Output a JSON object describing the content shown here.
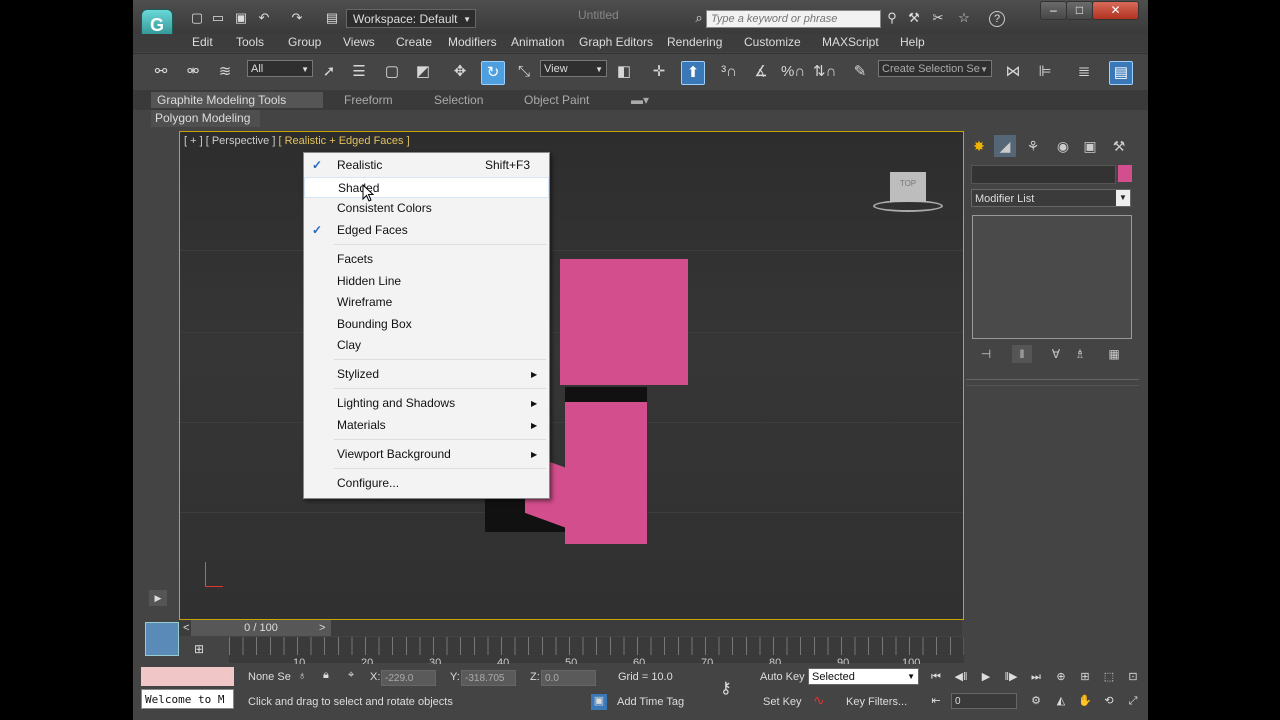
{
  "app": {
    "logo": "G",
    "workspace_label": "Workspace: Default",
    "window_title": "Untitled",
    "search_placeholder": "Type a keyword or phrase",
    "controls": {
      "minimize": "–",
      "maximize": "□",
      "close": "✕"
    }
  },
  "menu": {
    "items": [
      "Edit",
      "Tools",
      "Group",
      "Views",
      "Create",
      "Modifiers",
      "Animation",
      "Graph Editors",
      "Rendering",
      "Customize",
      "MAXScript",
      "Help"
    ]
  },
  "toolbar": {
    "filter_value": "All",
    "refcoord_value": "View",
    "selection_set_placeholder": "Create Selection Se"
  },
  "ribbon": {
    "tabs": [
      "Graphite Modeling Tools",
      "Freeform",
      "Selection",
      "Object Paint"
    ],
    "panel_label": "Polygon Modeling"
  },
  "viewport": {
    "label_plus": "[ + ]",
    "label_view": "[ Perspective ]",
    "label_shading": "[ Realistic + Edged Faces ]",
    "cube_label": "TOP",
    "object_color": "#d24e8c"
  },
  "context_menu": {
    "items": [
      {
        "label": "Realistic",
        "checked": "✓",
        "shortcut": "Shift+F3"
      },
      {
        "label": "Shaded"
      },
      {
        "label": "Consistent Colors"
      },
      {
        "label": "Edged Faces",
        "checked": "✓"
      },
      {
        "label": "Facets"
      },
      {
        "label": "Hidden Line"
      },
      {
        "label": "Wireframe"
      },
      {
        "label": "Bounding Box"
      },
      {
        "label": "Clay"
      },
      {
        "label": "Stylized",
        "submenu": "▶"
      },
      {
        "label": "Lighting and Shadows",
        "submenu": "▶"
      },
      {
        "label": "Materials",
        "submenu": "▶"
      },
      {
        "label": "Viewport Background",
        "submenu": "▶"
      },
      {
        "label": "Configure..."
      }
    ]
  },
  "command_panel": {
    "modifier_list": "Modifier List",
    "swatch_color": "#d24e8c"
  },
  "timeline": {
    "frame_display": "0 / 100",
    "prev": "<",
    "next": ">",
    "ticks": [
      "10",
      "20",
      "30",
      "40",
      "50",
      "60",
      "70",
      "80",
      "90",
      "100"
    ]
  },
  "status": {
    "script_listener": "Welcome to M",
    "selection_status": "None Se",
    "x_label": "X:",
    "x_value": "-229.0",
    "y_label": "Y:",
    "y_value": "-318.705",
    "z_label": "Z:",
    "z_value": "0.0",
    "grid": "Grid = 10.0",
    "prompt": "Click and drag to select and rotate objects",
    "add_time_tag": "Add Time Tag",
    "auto_key": "Auto Key",
    "set_key": "Set Key",
    "key_mode": "Selected",
    "key_filters": "Key Filters...",
    "current_frame": "0"
  }
}
